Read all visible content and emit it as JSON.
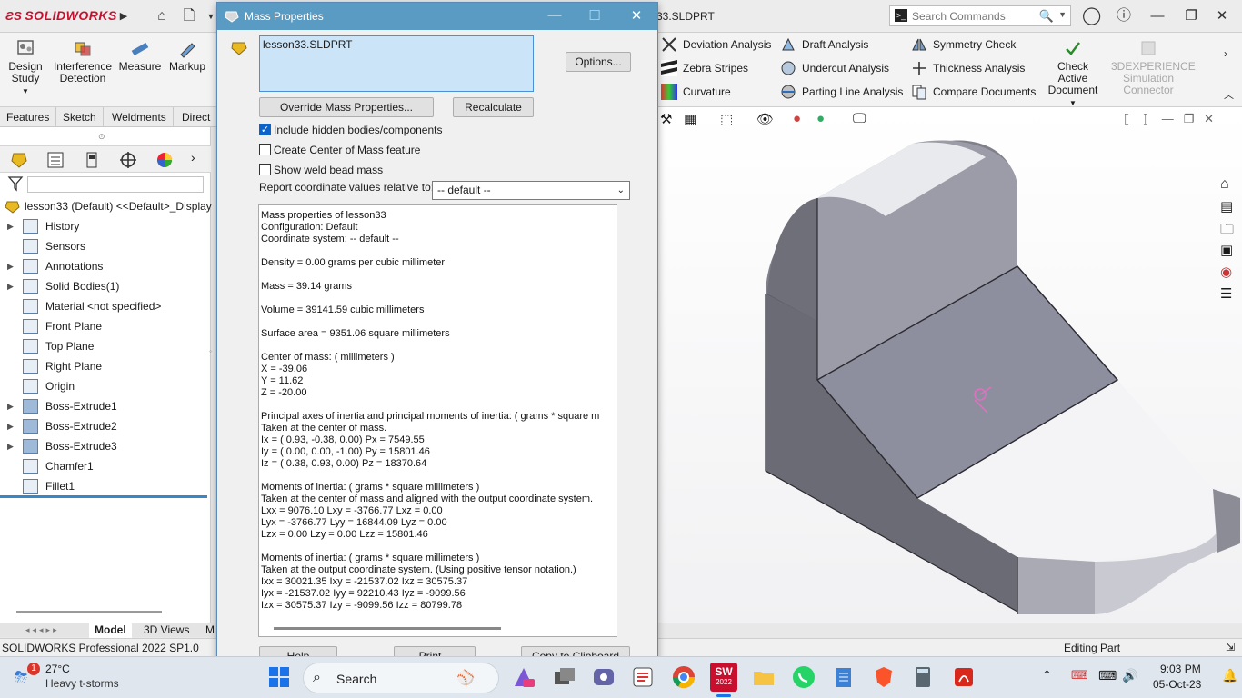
{
  "app": {
    "brand": "SOLIDWORKS",
    "doc_title": "33.SLDPRT",
    "search_placeholder": "Search Commands"
  },
  "ribbon": {
    "buttons": [
      {
        "label": "Design Study",
        "l1": "Design",
        "l2": "Study"
      },
      {
        "label": "Interference Detection",
        "l1": "Interference",
        "l2": "Detection"
      },
      {
        "label": "Measure"
      },
      {
        "label": "Markup"
      }
    ],
    "evaluate": [
      "Deviation Analysis",
      "Zebra Stripes",
      "Curvature",
      "Draft Analysis",
      "Undercut Analysis",
      "Parting Line Analysis",
      "Symmetry Check",
      "Thickness Analysis",
      "Compare Documents"
    ],
    "check_active": {
      "l1": "Check Active",
      "l2": "Document"
    },
    "experience": {
      "l1": "3DEXPERIENCE",
      "l2": "Simulation",
      "l3": "Connector"
    }
  },
  "cmd_tabs": [
    "Features",
    "Sketch",
    "Weldments",
    "Direct E"
  ],
  "tree": {
    "root": "lesson33 (Default) <<Default>_Display",
    "items": [
      {
        "label": "History",
        "expand": true
      },
      {
        "label": "Sensors",
        "expand": false
      },
      {
        "label": "Annotations",
        "expand": true
      },
      {
        "label": "Solid Bodies(1)",
        "expand": true
      },
      {
        "label": "Material <not specified>",
        "expand": false
      },
      {
        "label": "Front Plane",
        "expand": false
      },
      {
        "label": "Top Plane",
        "expand": false
      },
      {
        "label": "Right Plane",
        "expand": false
      },
      {
        "label": "Origin",
        "expand": false
      },
      {
        "label": "Boss-Extrude1",
        "expand": true
      },
      {
        "label": "Boss-Extrude2",
        "expand": true
      },
      {
        "label": "Boss-Extrude3",
        "expand": true
      },
      {
        "label": "Chamfer1",
        "expand": false
      },
      {
        "label": "Fillet1",
        "expand": false
      }
    ]
  },
  "bottom_tabs": [
    "Model",
    "3D Views",
    "M"
  ],
  "status": {
    "left": "SOLIDWORKS Professional 2022 SP1.0",
    "right": "Editing Part"
  },
  "dialog": {
    "title": "Mass Properties",
    "selection": "lesson33.SLDPRT",
    "options_btn": "Options...",
    "override_btn": "Override Mass Properties...",
    "recalc_btn": "Recalculate",
    "chk_hidden": "Include hidden bodies/components",
    "chk_com": "Create Center of Mass feature",
    "chk_weld": "Show weld bead mass",
    "report_label": "Report coordinate values relative to:",
    "coord_value": "-- default --",
    "help_btn": "Help",
    "print_btn": "Print...",
    "copy_btn": "Copy to Clipboard",
    "results": [
      "Mass properties of lesson33",
      "     Configuration: Default",
      "     Coordinate system: -- default --",
      "",
      "Density = 0.00 grams per cubic millimeter",
      "",
      "Mass = 39.14 grams",
      "",
      "Volume = 39141.59 cubic millimeters",
      "",
      "Surface area = 9351.06  square millimeters",
      "",
      "Center of mass: ( millimeters )",
      "        X = -39.06",
      "        Y = 11.62",
      "        Z = -20.00",
      "",
      "Principal axes of inertia and principal moments of inertia: ( grams *  square m",
      "Taken at the center of mass.",
      "        Ix = ( 0.93, -0.38,  0.00)             Px = 7549.55",
      "        Iy = ( 0.00,  0.00, -1.00)             Py = 15801.46",
      "        Iz = ( 0.38,  0.93,  0.00)             Pz = 18370.64",
      "",
      "Moments of inertia: ( grams *  square millimeters )",
      "Taken at the center of mass and aligned with the output coordinate system.",
      "        Lxx = 9076.10                    Lxy = -3766.77                  Lxz = 0.00",
      "        Lyx = -3766.77                  Lyy = 16844.09                Lyz = 0.00",
      "        Lzx = 0.00                          Lzy = 0.00                        Lzz = 15801.46",
      "",
      "Moments of inertia: ( grams *  square millimeters )",
      "Taken at the output coordinate system. (Using positive tensor notation.)",
      "        Ixx = 30021.35                  Ixy = -21537.02              Ixz = 30575.37",
      "        Iyx = -21537.02                Iyy = 92210.43               Iyz = -9099.56",
      "        Izx = 30575.37                 Izy = -9099.56                Izz = 80799.78"
    ]
  },
  "taskbar": {
    "weather_temp": "27°C",
    "weather_desc": "Heavy t-storms",
    "weather_badge": "1",
    "search": "Search",
    "time": "9:03 PM",
    "date": "05-Oct-23",
    "sw_year": "2022"
  },
  "colors": {
    "brand_red": "#c8102e",
    "dialog_title": "#5a9bc4",
    "selection_fill": "#cce4f7",
    "taskbar": "#dfe6ee"
  }
}
